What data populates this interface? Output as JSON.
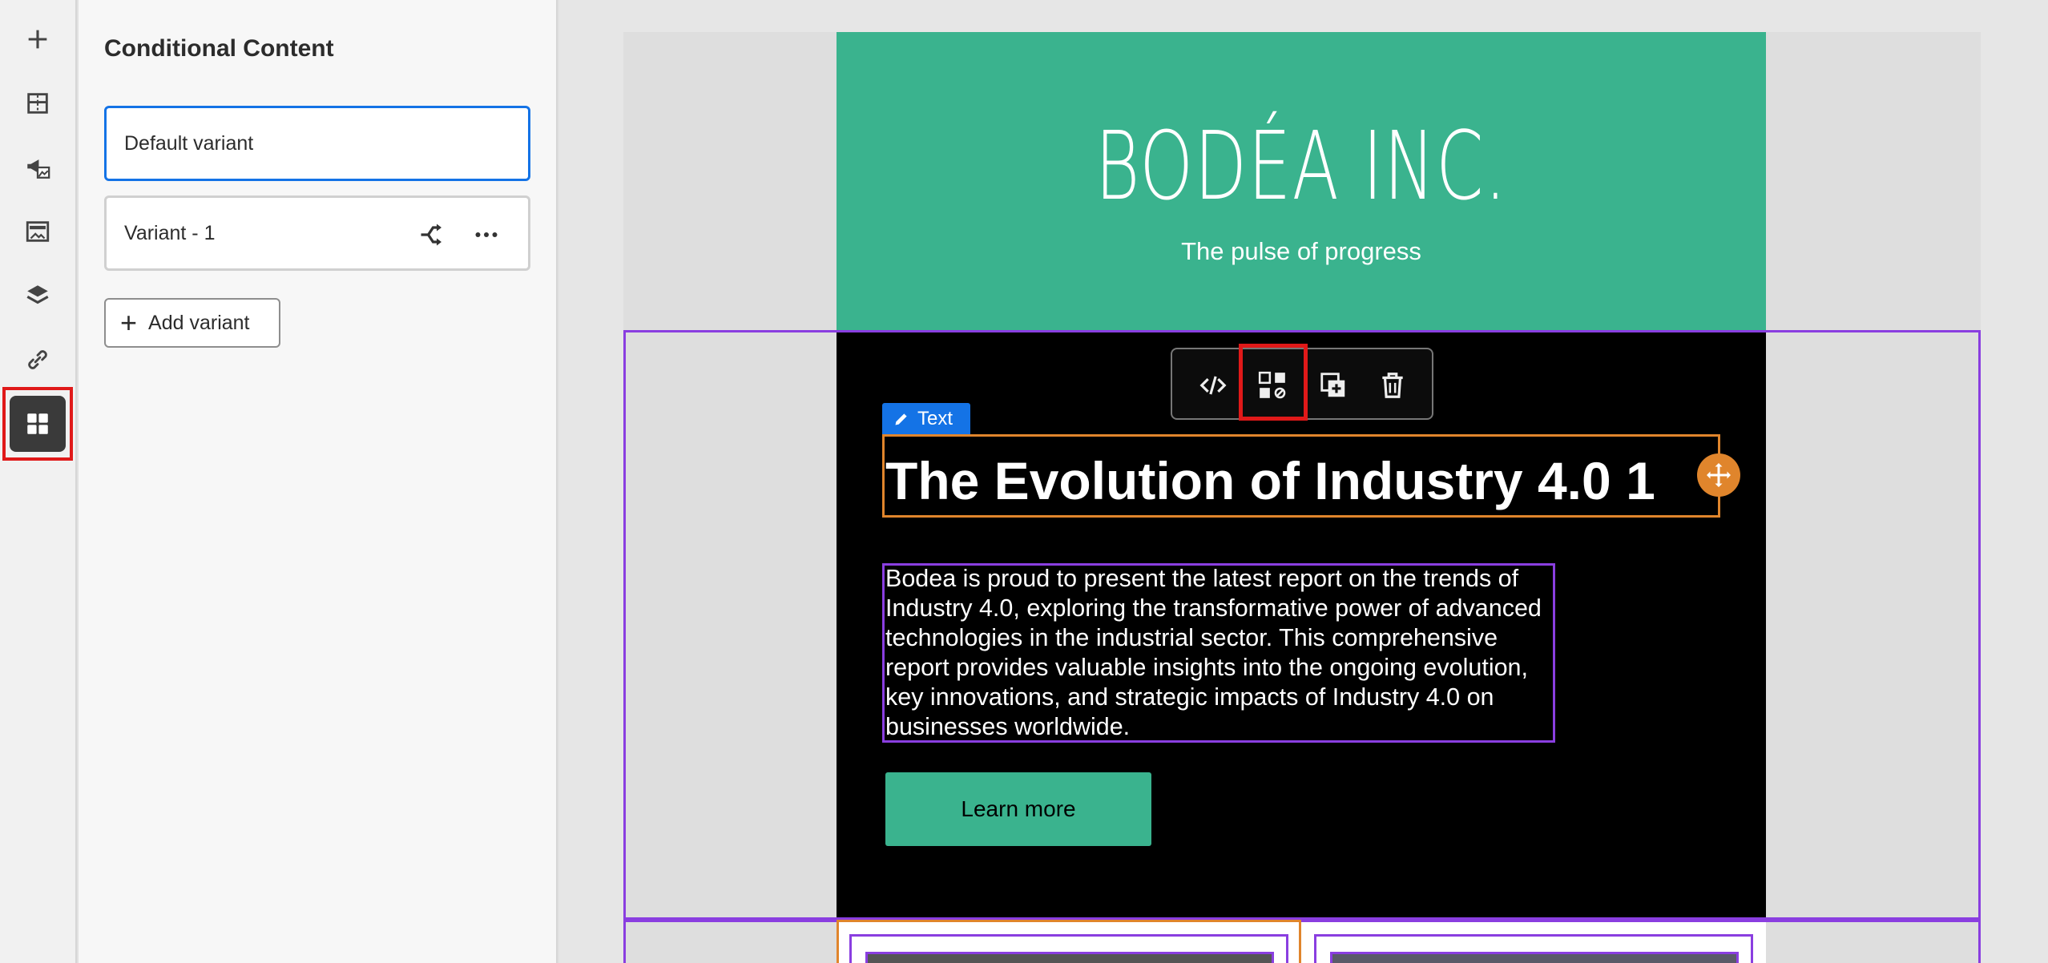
{
  "panel": {
    "title": "Conditional Content",
    "variants": [
      {
        "label": "Default variant"
      },
      {
        "label": "Variant - 1"
      }
    ],
    "add_variant_label": "Add variant"
  },
  "rail": {
    "icons": [
      "plus-icon",
      "structure-icon",
      "fragment-icon",
      "content-icon",
      "layers-icon",
      "link-icon",
      "conditional-content-icon"
    ]
  },
  "email": {
    "brand": "BODÉA INC.",
    "tagline": "The pulse of progress",
    "text_tag_label": "Text",
    "headline": "The Evolution of Industry 4.0 1",
    "body": "Bodea is proud to present the latest report on the trends of Industry 4.0, exploring the transformative power of advanced technologies in the industrial sector. This comprehensive report provides valuable insights into the ongoing evolution, key innovations, and strategic impacts of Industry 4.0 on businesses worldwide.",
    "cta_label": "Learn more"
  },
  "colors": {
    "accent": "#1473e6",
    "brand_green": "#3ab38e",
    "selection_purple": "#8a3ee0",
    "selection_orange": "#e0852c",
    "highlight_red": "#e01919"
  }
}
